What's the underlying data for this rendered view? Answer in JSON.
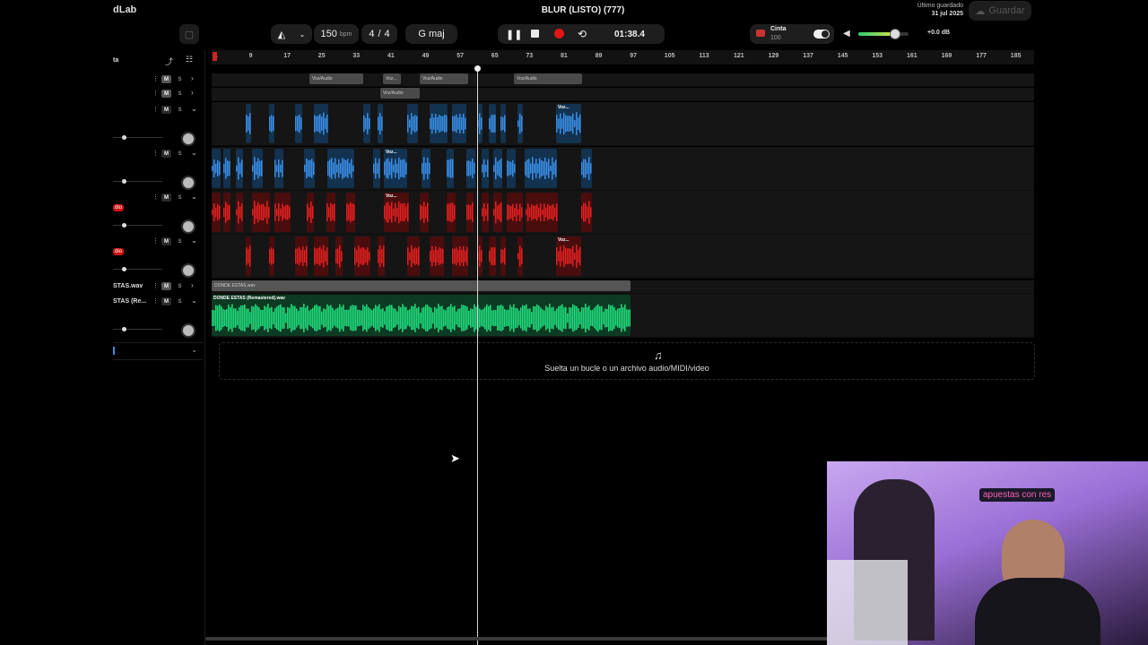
{
  "brand": "dLab",
  "title": "BLUR (LISTO) (777)",
  "transport": {
    "bpm": "150",
    "bpm_unit": "bpm",
    "time_signature_num": "4",
    "time_signature_sep": "/",
    "time_signature_den": "4",
    "key": "G maj",
    "time": "01:38.4"
  },
  "tape": {
    "label": "Cinta",
    "value": "100"
  },
  "volume": {
    "db": "+0.0 dB",
    "level": 0.72
  },
  "save": {
    "last_saved_label": "Último guardado",
    "last_saved_date": "31 jul 2025",
    "button": "Guardar"
  },
  "left_header": {
    "label": "ta"
  },
  "tracks": [
    {
      "name": "",
      "m": "M",
      "s": "S"
    },
    {
      "name": "",
      "m": "M",
      "s": "S"
    },
    {
      "name": "",
      "m": "M",
      "s": "S"
    },
    {
      "name": "",
      "m": "M",
      "s": "S"
    },
    {
      "name": "",
      "m": "M",
      "s": "S",
      "tag": "dio"
    },
    {
      "name": "",
      "m": "M",
      "s": "S",
      "tag": "dio"
    },
    {
      "name": "STAS.wav",
      "m": "M",
      "s": "S"
    },
    {
      "name": "STAS (Re...",
      "m": "M",
      "s": "S"
    }
  ],
  "ruler": [
    "1",
    "9",
    "17",
    "25",
    "33",
    "41",
    "49",
    "57",
    "65",
    "73",
    "81",
    "89",
    "97",
    "105",
    "113",
    "121",
    "129",
    "137",
    "145",
    "153",
    "161",
    "169",
    "177",
    "185"
  ],
  "clips": {
    "vox": "Voz/Audio",
    "vox_short": "Voz...",
    "donde": "DONDE ESTAS.wav",
    "donde_remaster": "DONDE ESTAS (Remastered).wav"
  },
  "drop_hint": "Suelta un bucle o un archivo audio/MIDI/video",
  "webcam": {
    "neon_sign": "apuestas con res"
  },
  "colors": {
    "blue": "#3a8ee6",
    "red": "#e02020",
    "green": "#1fd67a",
    "record": "#e01515"
  }
}
